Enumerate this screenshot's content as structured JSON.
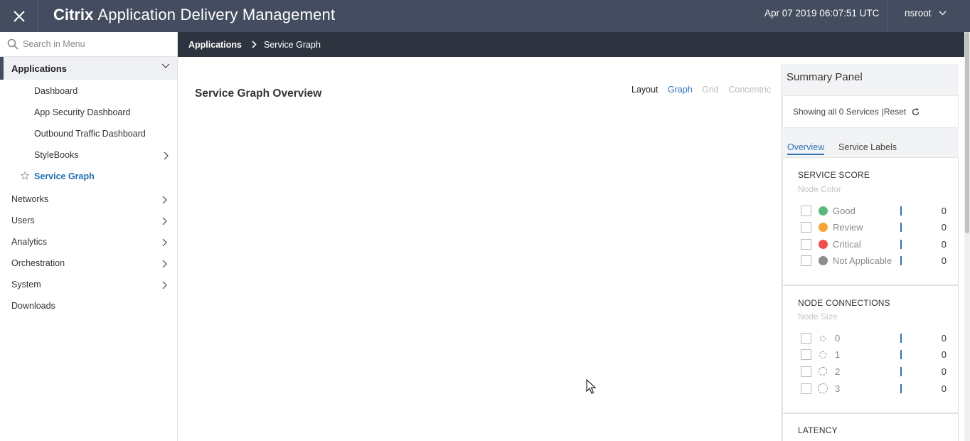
{
  "topbar": {
    "brand_strong": "Citrix",
    "brand_rest": "Application Delivery Management",
    "datetime": "Apr 07 2019 06:07:51 UTC",
    "user": "nsroot",
    "close_icon": "close-icon",
    "user_icon": "chevron-down-icon"
  },
  "sidebar": {
    "search_placeholder": "Search in Menu",
    "section": "Applications",
    "subitems": [
      {
        "label": "Dashboard"
      },
      {
        "label": "App Security Dashboard"
      },
      {
        "label": "Outbound Traffic Dashboard"
      },
      {
        "label": "StyleBooks"
      },
      {
        "label": "Service Graph"
      }
    ],
    "items": [
      {
        "label": "Networks"
      },
      {
        "label": "Users"
      },
      {
        "label": "Analytics"
      },
      {
        "label": "Orchestration"
      },
      {
        "label": "System"
      },
      {
        "label": "Downloads"
      }
    ]
  },
  "breadcrumb": {
    "parent": "Applications",
    "current": "Service Graph"
  },
  "main": {
    "title": "Service Graph Overview",
    "layout_label": "Layout",
    "layout_options": [
      "Graph",
      "Grid",
      "Concentric"
    ]
  },
  "panel": {
    "title": "Summary Panel",
    "showing": "Showing all 0 Services",
    "reset": "|Reset",
    "tabs": [
      "Overview",
      "Service Labels"
    ],
    "service_score": {
      "title": "SERVICE SCORE",
      "subtitle": "Node Color",
      "rows": [
        {
          "label": "Good",
          "count": "0",
          "color": "#5cb97d"
        },
        {
          "label": "Review",
          "count": "0",
          "color": "#f5a633"
        },
        {
          "label": "Critical",
          "count": "0",
          "color": "#ef4f4f"
        },
        {
          "label": "Not Applicable",
          "count": "0",
          "color": "#8c8c8c"
        }
      ]
    },
    "node_connections": {
      "title": "NODE CONNECTIONS",
      "subtitle": "Node Size",
      "rows": [
        {
          "label": "0",
          "count": "0"
        },
        {
          "label": "1",
          "count": "0"
        },
        {
          "label": "2",
          "count": "0"
        },
        {
          "label": "3",
          "count": "0"
        }
      ]
    },
    "latency": {
      "title": "LATENCY"
    }
  },
  "colors": {
    "topbar": "#434d5f",
    "crumbbar": "#2d3440",
    "accent": "#2f73b6"
  }
}
